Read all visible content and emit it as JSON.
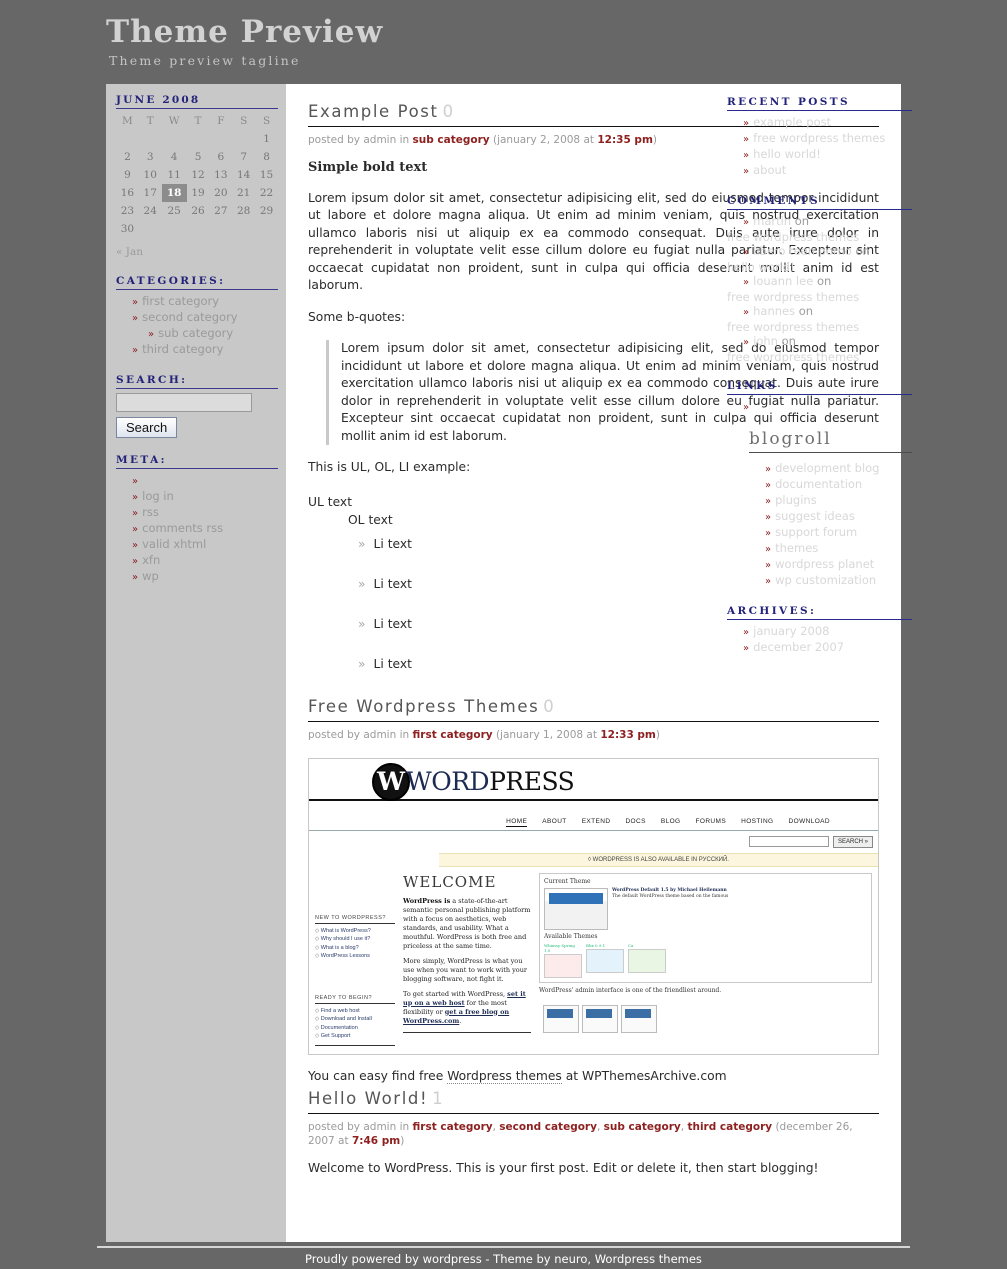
{
  "header": {
    "title": "Theme Preview",
    "tagline": "Theme preview tagline"
  },
  "left_sidebar": {
    "calendar": {
      "caption": "JUNE 2008",
      "weekdays": [
        "M",
        "T",
        "W",
        "T",
        "F",
        "S",
        "S"
      ],
      "weeks": [
        [
          "",
          "",
          "",
          "",
          "",
          "",
          "1"
        ],
        [
          "2",
          "3",
          "4",
          "5",
          "6",
          "7",
          "8"
        ],
        [
          "9",
          "10",
          "11",
          "12",
          "13",
          "14",
          "15"
        ],
        [
          "16",
          "17",
          "18",
          "19",
          "20",
          "21",
          "22"
        ],
        [
          "23",
          "24",
          "25",
          "26",
          "27",
          "28",
          "29"
        ],
        [
          "30",
          "",
          "",
          "",
          "",
          "",
          ""
        ]
      ],
      "today": "18",
      "prev_link": "« Jan"
    },
    "categories": {
      "title": "CATEGORIES:",
      "items": [
        {
          "label": "first category",
          "indent": false
        },
        {
          "label": "second category",
          "indent": false
        },
        {
          "label": "sub category",
          "indent": true
        },
        {
          "label": "third category",
          "indent": false
        }
      ]
    },
    "search": {
      "title": "SEARCH:",
      "value": "",
      "placeholder": "",
      "button_label": "Search"
    },
    "meta": {
      "title": "META:",
      "items": [
        {
          "label": ""
        },
        {
          "label": "log in"
        },
        {
          "label": "rss"
        },
        {
          "label": "comments rss"
        },
        {
          "label": "valid xhtml"
        },
        {
          "label": "xfn"
        },
        {
          "label": "wp"
        }
      ]
    }
  },
  "posts": [
    {
      "title": "Example Post",
      "comment_count": "0",
      "meta_prefix": "posted by admin in",
      "category_links": [
        "sub category"
      ],
      "meta_date": "(january 2, 2008 at",
      "meta_time": "12:35 pm",
      "meta_suffix": ")",
      "bold_line": "Simple bold text",
      "paragraph1": "Lorem ipsum dolor sit amet, consectetur adipisicing elit, sed do eiusmod tempor incididunt ut labore et dolore magna aliqua. Ut enim ad minim veniam, quis nostrud exercitation ullamco laboris nisi ut aliquip ex ea commodo consequat. Duis aute irure dolor in reprehenderit in voluptate velit esse cillum dolore eu fugiat nulla pariatur. Excepteur sint occaecat cupidatat non proident, sunt in culpa qui officia deserunt mollit anim id est laborum.",
      "bquote_lead": "Some b-quotes:",
      "blockquote": "Lorem ipsum dolor sit amet, consectetur adipisicing elit, sed do eiusmod tempor incididunt ut labore et dolore magna aliqua. Ut enim ad minim veniam, quis nostrud exercitation ullamco laboris nisi ut aliquip ex ea commodo consequat. Duis aute irure dolor in reprehenderit in voluptate velit esse cillum dolore eu fugiat nulla pariatur. Excepteur sint occaecat cupidatat non proident, sunt in culpa qui officia deserunt mollit anim id est laborum.",
      "list_lead": "This is UL, OL, LI example:",
      "ul_text": "UL text",
      "ol_text": "OL text",
      "li_items": [
        "Li text",
        "Li text",
        "Li text",
        "Li text"
      ]
    },
    {
      "title": "Free Wordpress Themes",
      "comment_count": "0",
      "meta_prefix": "posted by admin in",
      "category_links": [
        "first category"
      ],
      "meta_date": "(january 1, 2008 at",
      "meta_time": "12:33 pm",
      "meta_suffix": ")",
      "after_figure_pre": "You can easy find free ",
      "after_figure_link": "Wordpress themes",
      "after_figure_post": " at WPThemesArchive.com"
    },
    {
      "title": "Hello World!",
      "comment_count": "1",
      "meta_prefix": "posted by admin in",
      "category_links": [
        "first category",
        "second category",
        "sub category",
        "third category"
      ],
      "meta_date": "(december 26, 2007 at",
      "meta_time": "7:46 pm",
      "meta_suffix": ")",
      "paragraph1": "Welcome to WordPress. This is your first post. Edit or delete it, then start blogging!"
    }
  ],
  "wordpress_screenshot": {
    "logo_w": "W",
    "logo_word_first": "W",
    "logo_word_rest": "ORD",
    "logo_word_p": "P",
    "logo_word_ress": "RESS",
    "nav": [
      "HOME",
      "ABOUT",
      "EXTEND",
      "DOCS",
      "BLOG",
      "FORUMS",
      "HOSTING",
      "DOWNLOAD"
    ],
    "nav_active": "HOME",
    "search_button": "SEARCH »",
    "notice": "◊ WORDPRESS IS ALSO AVAILABLE IN РУССКИЙ.",
    "new_to_heading": "NEW TO WORDPRESS?",
    "new_to_links": [
      "What is WordPress?",
      "Why should I use it?",
      "What is a blog?",
      "WordPress Lessons"
    ],
    "ready_heading": "READY TO BEGIN?",
    "ready_links": [
      "Find a web host",
      "Download and Install",
      "Documentation",
      "Get Support"
    ],
    "welcome_heading": "WELCOME",
    "welcome_p1_bold": "WordPress is",
    "welcome_p1": " a state-of-the-art semantic personal publishing platform with a focus on aesthetics, web standards, and usability. What a mouthful. WordPress is both free and priceless at the same time.",
    "welcome_p2": "More simply, WordPress is what you use when you want to work with your blogging software, not fight it.",
    "welcome_p3_pre": "To get started with WordPress, ",
    "welcome_p3_link1": "set it up on a web host",
    "welcome_p3_mid": " for the most flexibility or ",
    "welcome_p3_link2": "get a free blog on WordPress.com",
    "welcome_p3_post": ".",
    "panel_current_theme": "Current Theme",
    "panel_theme_name": "WordPress Default 1.5 by Michael Heilemann",
    "panel_theme_desc": "The default WordPress theme based on the famous",
    "panel_available": "Available Themes",
    "panel_themes": [
      "Whimsy Spring 1.0",
      "Blix 0.9.1",
      "Ca"
    ],
    "panel_caption": "WordPress' admin interface is one of the friendliest around."
  },
  "right_sidebar": {
    "recent_posts": {
      "title": "RECENT POSTS",
      "items": [
        "example post",
        "free wordpress themes",
        "hello world!",
        "about"
      ]
    },
    "comments": {
      "title": "COMMENTS",
      "items": [
        {
          "who": "martin",
          "on": "on",
          "post": "free wordpress themes"
        },
        {
          "who": "libero teen porno",
          "on": "on",
          "post": "hello world!"
        },
        {
          "who": "louann lee",
          "on": "on",
          "post": "free wordpress themes"
        },
        {
          "who": "hannes",
          "on": "on",
          "post": "free wordpress themes"
        },
        {
          "who": "john",
          "on": "on",
          "post": "free wordpress themes"
        }
      ]
    },
    "links": {
      "title": "LINKS",
      "items": [
        ""
      ],
      "blogroll_title": "blogroll",
      "blogroll_items": [
        "development blog",
        "documentation",
        "plugins",
        "suggest ideas",
        "support forum",
        "themes",
        "wordpress planet",
        "wp customization"
      ]
    },
    "archives": {
      "title": "ARCHIVES:",
      "items": [
        "january 2008",
        "december 2007"
      ]
    }
  },
  "footer": {
    "text": "Proudly powered by wordpress - Theme by neuro, Wordpress themes"
  },
  "colors": {
    "page_bg": "#676767",
    "sidebar_bg": "#c8c8c8",
    "content_bg": "#ffffff",
    "heading_blue": "#22227a",
    "link_red": "#8e2020",
    "muted": "#9a9a9a"
  }
}
